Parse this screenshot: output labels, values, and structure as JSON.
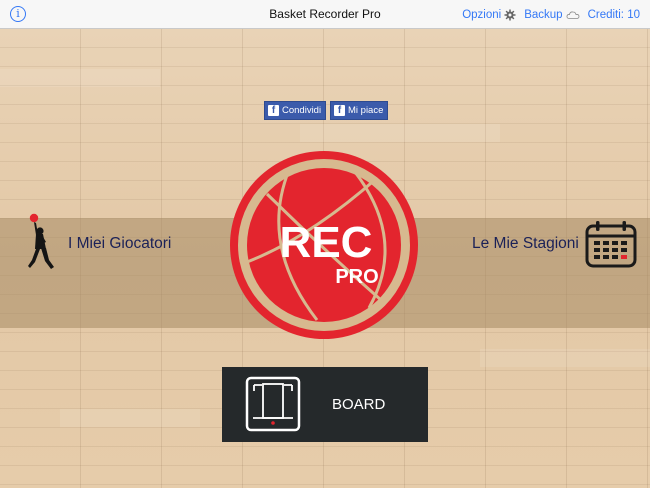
{
  "nav": {
    "title": "Basket Recorder Pro",
    "info_icon": "info-icon",
    "options_label": "Opzioni",
    "options_icon": "gear-icon",
    "backup_label": "Backup",
    "backup_icon": "cloud-icon",
    "credits_label": "Crediti: 10",
    "accent_color": "#3478f6"
  },
  "social": {
    "share_label": "Condividi",
    "like_label": "Mi piace",
    "icon": "facebook-icon",
    "color": "#3b5bab"
  },
  "players": {
    "label": "I Miei Giocatori",
    "icon": "basketball-player-icon"
  },
  "seasons": {
    "label": "Le Mie Stagioni",
    "icon": "calendar-icon"
  },
  "logo": {
    "text_main": "REC",
    "text_sub": "PRO",
    "color": "#e3252e"
  },
  "board": {
    "label": "BOARD",
    "icon": "court-board-icon"
  }
}
